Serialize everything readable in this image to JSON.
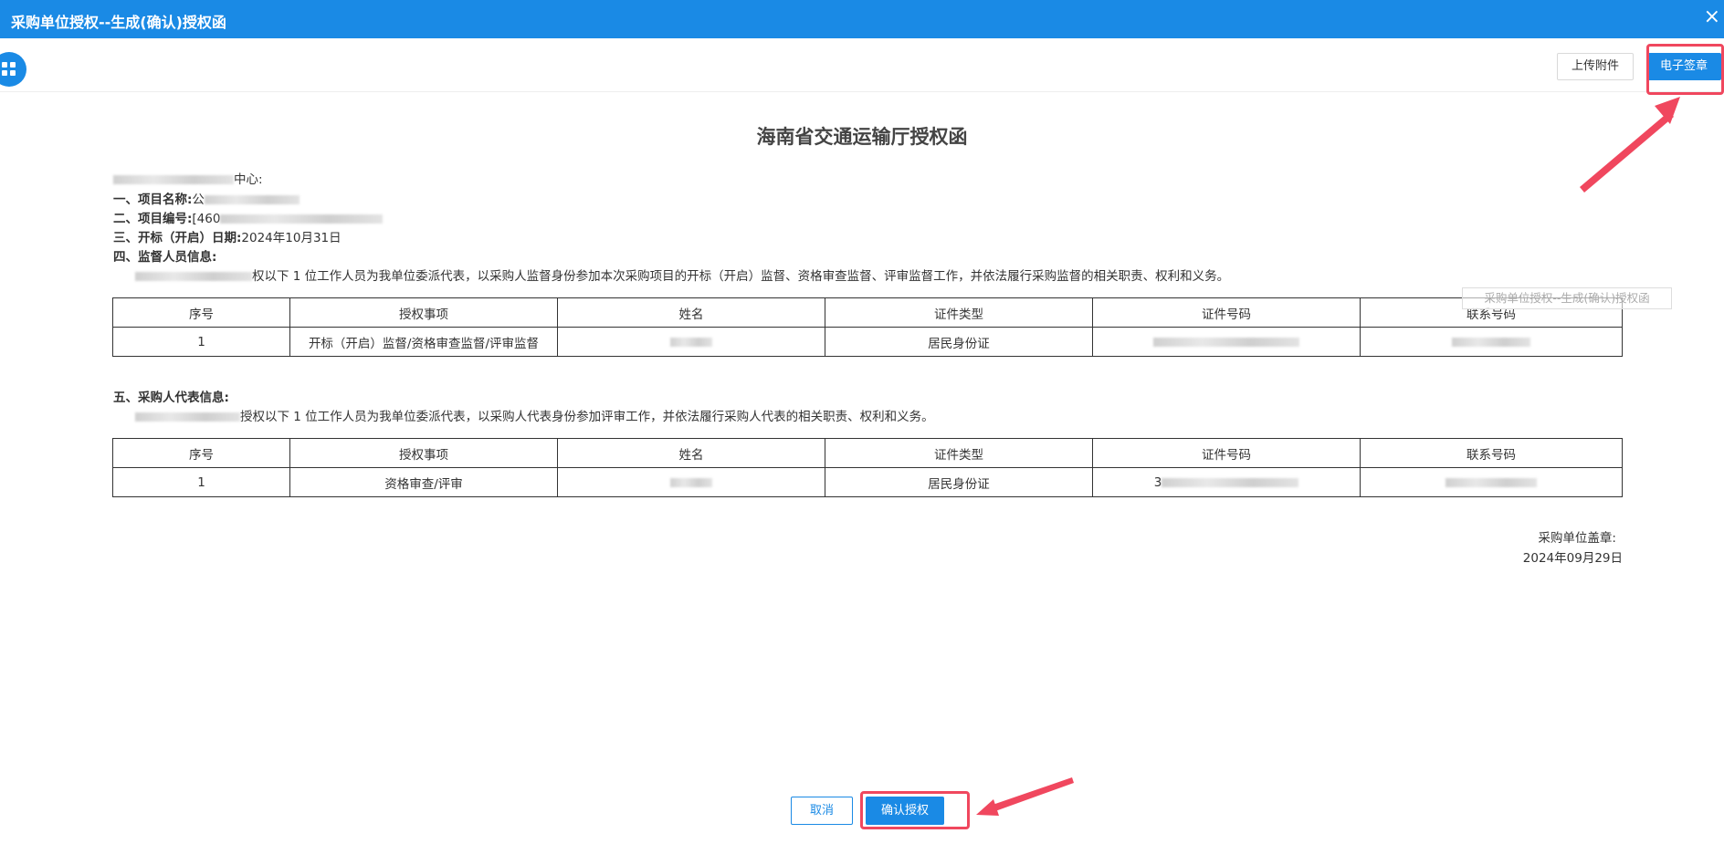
{
  "window": {
    "title": "采购单位授权--生成(确认)授权函",
    "close_glyph": "×"
  },
  "toolbar": {
    "upload_label": "上传附件",
    "sign_label": "电子签章"
  },
  "document": {
    "title": "海南省交通运输厅授权函",
    "addressee_suffix": "中心:",
    "project_name_label": "一、项目名称:",
    "project_name_value": "公",
    "project_no_label": "二、项目编号:",
    "project_no_value": "[460",
    "open_date_label": "三、开标（开启）日期:",
    "open_date_value": "2024年10月31日",
    "supervisor_heading": "四、监督人员信息:",
    "supervisor_text": "权以下 1 位工作人员为我单位委派代表，以采购人监督身份参加本次采购项目的开标（开启）监督、资格审查监督、评审监督工作，并依法履行采购监督的相关职责、权利和义务。",
    "rep_heading": "五、采购人代表信息:",
    "rep_text": "授权以下 1 位工作人员为我单位委派代表，以采购人代表身份参加评审工作，并依法履行采购人代表的相关职责、权利和义务。",
    "sign_label": "采购单位盖章:",
    "sign_date": "2024年09月29日"
  },
  "supervisor_table": {
    "headers": [
      "序号",
      "授权事项",
      "姓名",
      "证件类型",
      "证件号码",
      "联系号码"
    ],
    "rows": [
      {
        "index": "1",
        "matter": "开标（开启）监督/资格审查监督/评审监督",
        "id_type": "居民身份证",
        "id_prefix": ""
      }
    ]
  },
  "rep_table": {
    "headers": [
      "序号",
      "授权事项",
      "姓名",
      "证件类型",
      "证件号码",
      "联系号码"
    ],
    "rows": [
      {
        "index": "1",
        "matter": "资格审查/评审",
        "id_type": "居民身份证",
        "id_prefix": "3"
      }
    ]
  },
  "watermark": "采购单位授权--生成(确认)授权函",
  "footer": {
    "cancel_label": "取消",
    "confirm_label": "确认授权"
  },
  "colors": {
    "primary": "#1a8ae5",
    "highlight": "#f0475e"
  }
}
